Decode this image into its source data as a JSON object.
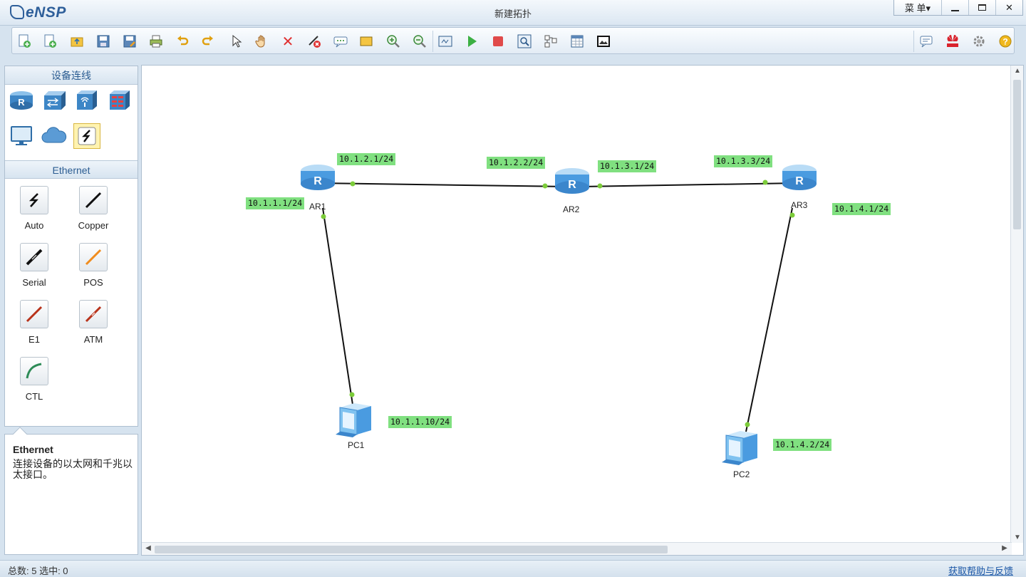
{
  "app": {
    "name": "eNSP",
    "window_title": "新建拓扑"
  },
  "window_controls": {
    "menu_label": "菜 单▾",
    "close_glyph": "✕"
  },
  "toolbar": {
    "buttons": [
      "new-topology-icon",
      "new-exam-icon",
      "open-icon",
      "save-icon",
      "save-as-icon",
      "print-icon",
      "undo-icon",
      "redo-icon",
      "select-icon",
      "pan-hand-icon",
      "delete-icon",
      "delete-connections-icon",
      "text-label-icon",
      "rectangle-icon",
      "zoom-in-icon",
      "zoom-out-icon",
      "fit-icon",
      "start-device-icon",
      "stop-device-icon",
      "capture-icon",
      "topology-icon",
      "grid-icon",
      "screenshot-icon",
      "chat-icon",
      "huawei-icon",
      "settings-icon",
      "help-icon"
    ]
  },
  "left_panel": {
    "device_header": "设备连线",
    "devices": [
      "router-icon",
      "switch-icon",
      "wireless-icon",
      "firewall-icon",
      "pc-icon",
      "cloud-icon",
      "connection-icon"
    ],
    "cable_header": "Ethernet",
    "cables": [
      {
        "label": "Auto",
        "color": "#111111"
      },
      {
        "label": "Copper",
        "color": "#111111"
      },
      {
        "label": "Serial",
        "color": "#111111"
      },
      {
        "label": "POS",
        "color": "#f08c1e"
      },
      {
        "label": "E1",
        "color": "#b8321a"
      },
      {
        "label": "ATM",
        "color": "#b8321a"
      },
      {
        "label": "CTL",
        "color": "#2e8b57"
      }
    ]
  },
  "description": {
    "title": "Ethernet",
    "text": "连接设备的以太网和千兆以太接口。"
  },
  "topology": {
    "nodes": [
      {
        "name": "AR1",
        "type": "router"
      },
      {
        "name": "AR2",
        "type": "router"
      },
      {
        "name": "AR3",
        "type": "router"
      },
      {
        "name": "PC1",
        "type": "pc"
      },
      {
        "name": "PC2",
        "type": "pc"
      }
    ],
    "links": [
      {
        "from": "AR1",
        "to": "AR2"
      },
      {
        "from": "AR2",
        "to": "AR3"
      },
      {
        "from": "AR1",
        "to": "PC1"
      },
      {
        "from": "AR3",
        "to": "PC2"
      }
    ],
    "ip_labels": [
      "10.1.2.1/24",
      "10.1.2.2/24",
      "10.1.3.1/24",
      "10.1.3.3/24",
      "10.1.1.1/24",
      "10.1.4.1/24",
      "10.1.1.10/24",
      "10.1.4.2/24"
    ],
    "link_color": "#111111",
    "port_color": "#7ccc3a",
    "ip_label_bg": "#80e080"
  },
  "status": {
    "text": "总数: 5  选中: 0",
    "help_link": "获取帮助与反馈"
  }
}
